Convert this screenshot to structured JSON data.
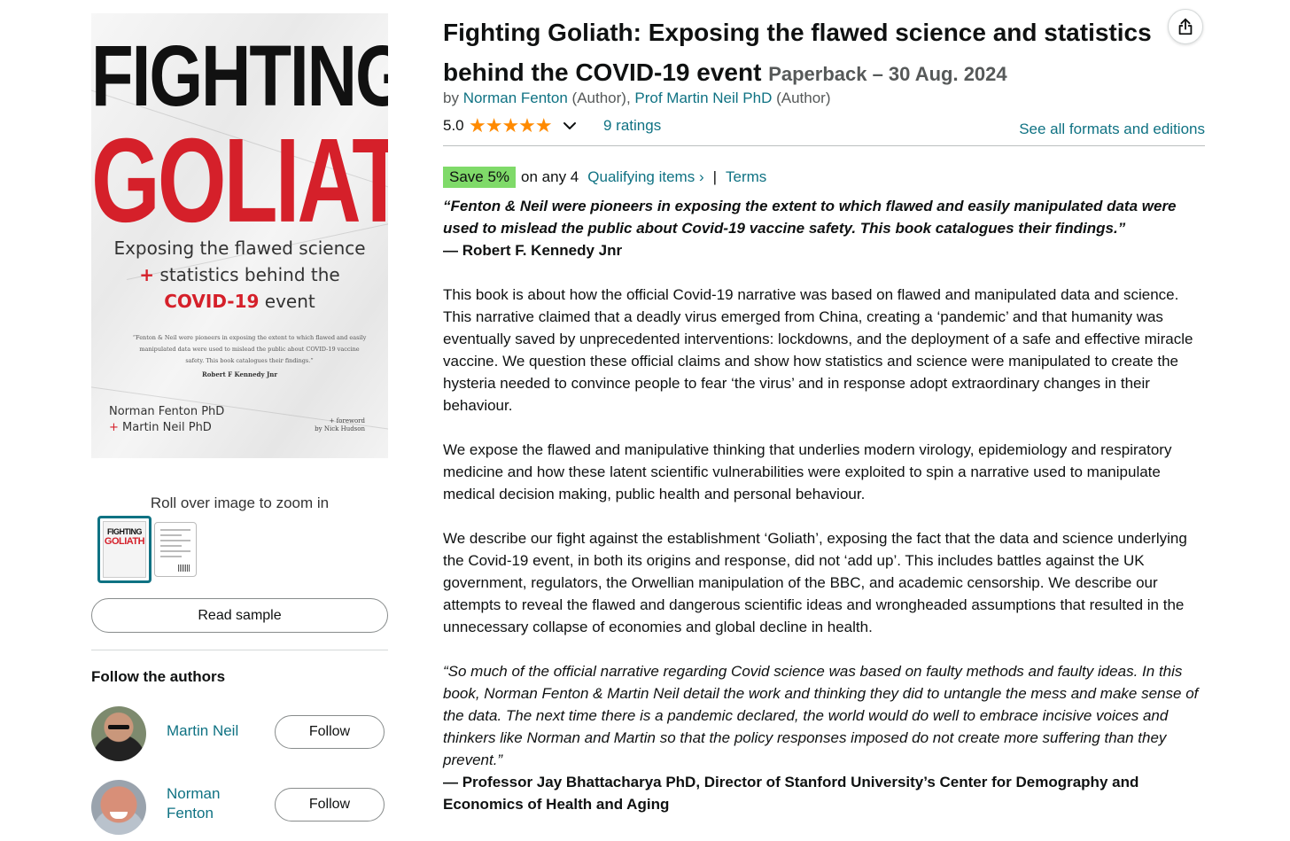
{
  "cover": {
    "title_line1": "FIGHTING",
    "title_line2": "GOLIATH",
    "subtitle_line1": "Exposing the flawed science",
    "subtitle_plus": "+",
    "subtitle_line2": " statistics behind the",
    "subtitle_red": "COVID-19",
    "subtitle_end": " event",
    "quote": "“Fenton & Neil were pioneers in exposing the extent to which flawed and easily manipulated data were used to mislead the public about COVID-19 vaccine safety. This book catalogues their findings.”",
    "quote_by": "Robert F Kennedy Jnr",
    "author1": "Norman Fenton PhD",
    "author2_plus": "+",
    "author2": " Martin Neil PhD",
    "foreword_line1": "+ foreword",
    "foreword_line2": "by Nick Hudson"
  },
  "gallery": {
    "zoom_hint": "Roll over image to zoom in",
    "thumb_active_line1": "FIGHTING",
    "thumb_active_line2": "GOLIATH"
  },
  "actions": {
    "read_sample": "Read sample"
  },
  "authors": {
    "heading": "Follow the authors",
    "list": [
      {
        "name": "Martin Neil",
        "follow_label": "Follow"
      },
      {
        "name": "Norman Fenton",
        "follow_label": "Follow"
      }
    ]
  },
  "product": {
    "title": "Fighting Goliath: Exposing the flawed science and statistics behind the COVID-19 event",
    "format": "Paperback – 30 Aug. 2024",
    "by_prefix": "by ",
    "author1": "Norman Fenton",
    "author1_role": " (Author), ",
    "author2": "Prof Martin Neil PhD",
    "author2_role": " (Author)",
    "rating_value": "5.0",
    "stars": "★★★★★",
    "ratings_count": "9 ratings",
    "formats_link": "See all formats and editions"
  },
  "promo": {
    "badge": "Save 5%",
    "text": "on any 4",
    "link": "Qualifying items ›",
    "separator": "|",
    "terms": "Terms"
  },
  "description": {
    "quote1": "“Fenton & Neil were pioneers in exposing the extent to which flawed and easily manipulated data were used to mislead the public about Covid-19 vaccine safety. This book catalogues their findings.”",
    "quote1_by": "— Robert F. Kennedy Jnr",
    "para1": "This book is about how the official Covid-19 narrative was based on flawed and manipulated data and science. This narrative claimed that a deadly virus emerged from China, creating a ‘pandemic’ and that humanity was eventually saved by unprecedented interventions: lockdowns, and the deployment of a safe and effective miracle vaccine. We question these official claims and show how statistics and science were manipulated to create the hysteria needed to convince people to fear ‘the virus’ and in response adopt extraordinary changes in their behaviour.",
    "para2": "We expose the flawed and manipulative thinking that underlies modern virology, epidemiology and respiratory medicine and how these latent scientific vulnerabilities were exploited to spin a narrative used to manipulate medical decision making, public health and personal behaviour.",
    "para3": "We describe our fight against the establishment ‘Goliath’, exposing the fact that the data and science underlying the Covid-19 event, in both its origins and response, did not ‘add up’. This includes battles against the UK government, regulators, the Orwellian manipulation of the BBC, and academic censorship. We describe our attempts to reveal the flawed and dangerous scientific ideas and wrongheaded assumptions that resulted in the unnecessary collapse of economies and global decline in health.",
    "quote2": "“So much of the official narrative regarding Covid science was based on faulty methods and faulty ideas. In this book, Norman Fenton & Martin Neil detail the work and thinking they did to untangle the mess and make sense of the data. The next time there is a pandemic declared, the world would do well to embrace incisive voices and thinkers like Norman and Martin so that the policy responses imposed do not create more suffering than they prevent.”",
    "quote2_by": "— Professor Jay Bhattacharya PhD, Director of Stanford University’s Center for Demography and Economics of Health and Aging"
  },
  "icons": {
    "share": "share-icon",
    "chevron": "chevron-down-icon"
  },
  "colors": {
    "link": "#0f7283",
    "star": "#ff8a00",
    "badge": "#7fda69",
    "cover_red": "#d5202a"
  }
}
